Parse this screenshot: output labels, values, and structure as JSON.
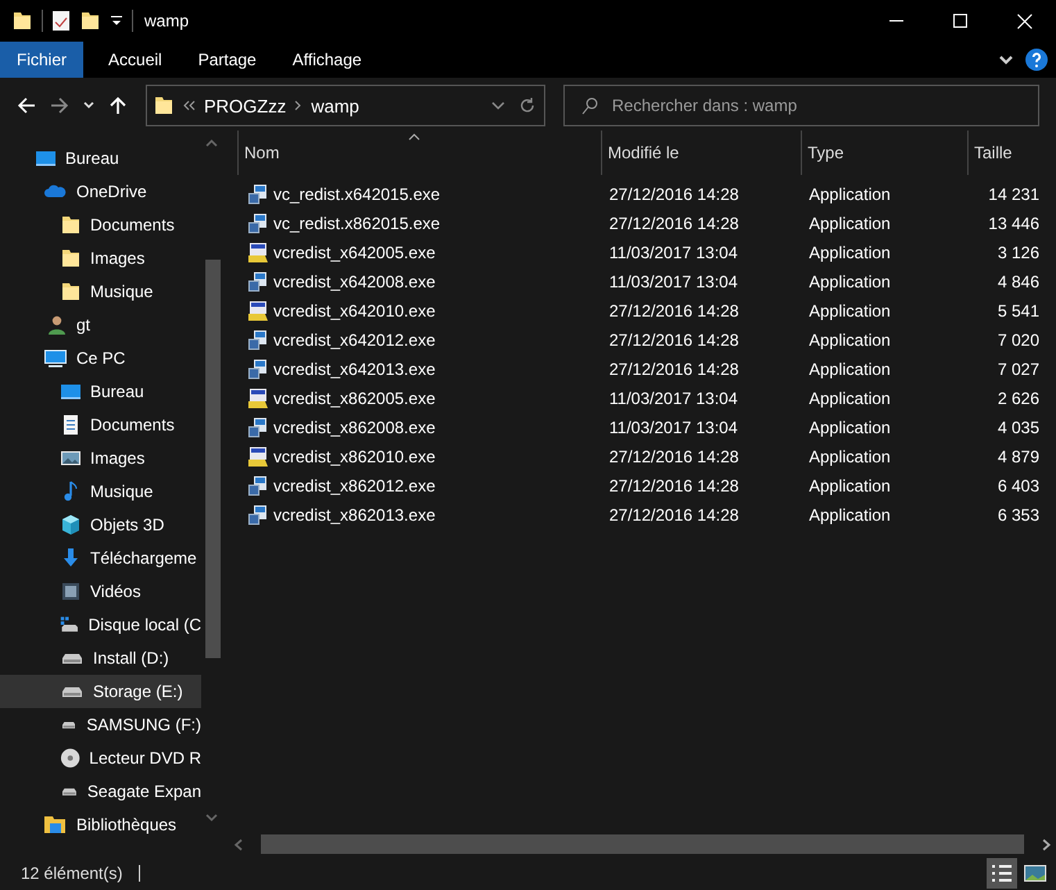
{
  "window": {
    "title": "wamp"
  },
  "ribbon_tabs": [
    {
      "label": "Fichier",
      "kind": "file"
    },
    {
      "label": "Accueil",
      "kind": "tab"
    },
    {
      "label": "Partage",
      "kind": "tab"
    },
    {
      "label": "Affichage",
      "kind": "tab"
    }
  ],
  "address_bar": {
    "path": [
      {
        "label": "PROGZzz"
      },
      {
        "label": "wamp"
      }
    ]
  },
  "search": {
    "placeholder": "Rechercher dans : wamp"
  },
  "sidebar": {
    "items": [
      {
        "label": "Bureau",
        "kind": "desktop",
        "selected": false,
        "children": [
          {
            "label": "OneDrive",
            "kind": "cloud",
            "selected": false,
            "children": [
              {
                "label": "Documents",
                "kind": "folder",
                "selected": false
              },
              {
                "label": "Images",
                "kind": "folder",
                "selected": false
              },
              {
                "label": "Musique",
                "kind": "folder",
                "selected": false
              }
            ]
          },
          {
            "label": "gt",
            "kind": "user",
            "selected": false
          },
          {
            "label": "Ce PC",
            "kind": "pc",
            "selected": false,
            "children": [
              {
                "label": "Bureau",
                "kind": "desktop",
                "selected": false
              },
              {
                "label": "Documents",
                "kind": "documents",
                "selected": false
              },
              {
                "label": "Images",
                "kind": "images",
                "selected": false
              },
              {
                "label": "Musique",
                "kind": "music",
                "selected": false
              },
              {
                "label": "Objets 3D",
                "kind": "objects3d",
                "selected": false
              },
              {
                "label": "Téléchargeme",
                "kind": "download",
                "selected": false
              },
              {
                "label": "Vidéos",
                "kind": "videos",
                "selected": false
              },
              {
                "label": "Disque local (C",
                "kind": "system-drive",
                "selected": false
              },
              {
                "label": "Install (D:)",
                "kind": "drive",
                "selected": false
              },
              {
                "label": "Storage (E:)",
                "kind": "drive",
                "selected": true
              },
              {
                "label": "SAMSUNG (F:)",
                "kind": "drive",
                "selected": false
              },
              {
                "label": "Lecteur DVD R",
                "kind": "dvd",
                "selected": false
              },
              {
                "label": "Seagate Expan",
                "kind": "drive",
                "selected": false
              }
            ]
          },
          {
            "label": "Bibliothèques",
            "kind": "library",
            "selected": false
          }
        ]
      }
    ]
  },
  "table": {
    "columns": [
      "Nom",
      "Modifié le",
      "Type",
      "Taille"
    ],
    "rows": [
      {
        "name": "vc_redist.x642015.exe",
        "kind": "redist",
        "modified": "27/12/2016 14:28",
        "type": "Application",
        "size": "14 231"
      },
      {
        "name": "vc_redist.x862015.exe",
        "kind": "redist",
        "modified": "27/12/2016 14:28",
        "type": "Application",
        "size": "13 446"
      },
      {
        "name": "vcredist_x642005.exe",
        "kind": "setup",
        "modified": "11/03/2017 13:04",
        "type": "Application",
        "size": "3 126"
      },
      {
        "name": "vcredist_x642008.exe",
        "kind": "redist",
        "modified": "11/03/2017 13:04",
        "type": "Application",
        "size": "4 846"
      },
      {
        "name": "vcredist_x642010.exe",
        "kind": "setup",
        "modified": "27/12/2016 14:28",
        "type": "Application",
        "size": "5 541"
      },
      {
        "name": "vcredist_x642012.exe",
        "kind": "redist",
        "modified": "27/12/2016 14:28",
        "type": "Application",
        "size": "7 020"
      },
      {
        "name": "vcredist_x642013.exe",
        "kind": "redist",
        "modified": "27/12/2016 14:28",
        "type": "Application",
        "size": "7 027"
      },
      {
        "name": "vcredist_x862005.exe",
        "kind": "setup",
        "modified": "11/03/2017 13:04",
        "type": "Application",
        "size": "2 626"
      },
      {
        "name": "vcredist_x862008.exe",
        "kind": "redist",
        "modified": "11/03/2017 13:04",
        "type": "Application",
        "size": "4 035"
      },
      {
        "name": "vcredist_x862010.exe",
        "kind": "setup",
        "modified": "27/12/2016 14:28",
        "type": "Application",
        "size": "4 879"
      },
      {
        "name": "vcredist_x862012.exe",
        "kind": "redist",
        "modified": "27/12/2016 14:28",
        "type": "Application",
        "size": "6 403"
      },
      {
        "name": "vcredist_x862013.exe",
        "kind": "redist",
        "modified": "27/12/2016 14:28",
        "type": "Application",
        "size": "6 353"
      }
    ]
  },
  "status_bar": {
    "count": "12 élément(s)"
  }
}
